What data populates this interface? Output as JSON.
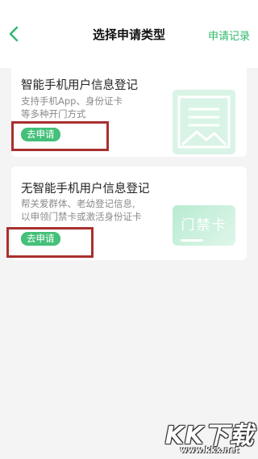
{
  "header": {
    "title": "选择申请类型",
    "action_label": "申请记录"
  },
  "cards": [
    {
      "title": "智能手机用户信息登记",
      "desc_lines": [
        "支持手机App、身份证卡",
        "等多种开门方式"
      ],
      "button_label": "去申请",
      "icon": "document-icon"
    },
    {
      "title": "无智能手机用户信息登记",
      "desc_lines": [
        "帮关爱群体、老幼登记信息,",
        "以申领门禁卡或激活身份证卡"
      ],
      "button_label": "去申请",
      "icon": "access-card-icon",
      "illustration_text": "门禁卡"
    }
  ],
  "watermark": {
    "logo": "KK下载",
    "url": "www.kkx.net"
  },
  "colors": {
    "accent": "#2fb96a",
    "button": "#43c079",
    "highlight": "#a8302e",
    "background": "#f4f4f4"
  }
}
